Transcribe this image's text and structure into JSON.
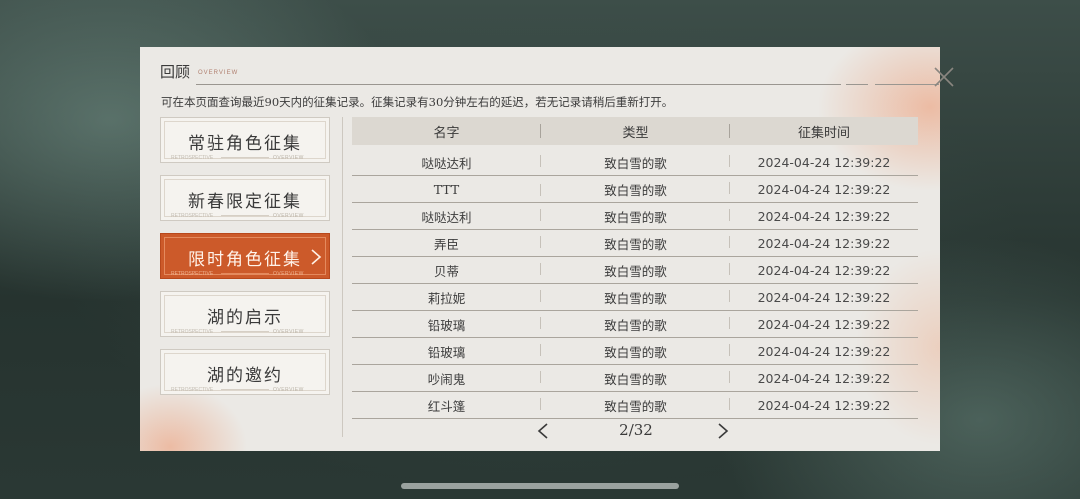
{
  "header": {
    "title": "回顾",
    "subtitle": "OVERVIEW",
    "notice": "可在本页面查询最近90天内的征集记录。征集记录有30分钟左右的延迟，若无记录请稍后重新打开。"
  },
  "tabs": [
    {
      "label": "常驻角色征集",
      "active": false,
      "deco": "OVERVIEW",
      "deco_left": "RETROSPECTIVE"
    },
    {
      "label": "新春限定征集",
      "active": false,
      "deco": "OVERVIEW",
      "deco_left": "RETROSPECTIVE"
    },
    {
      "label": "限时角色征集",
      "active": true,
      "deco": "OVERVIEW",
      "deco_left": "RETROSPECTIVE"
    },
    {
      "label": "湖的启示",
      "active": false,
      "deco": "OVERVIEW",
      "deco_left": "RETROSPECTIVE"
    },
    {
      "label": "湖的邀约",
      "active": false,
      "deco": "OVERVIEW",
      "deco_left": "RETROSPECTIVE"
    }
  ],
  "table": {
    "columns": [
      "名字",
      "类型",
      "征集时间"
    ],
    "rows": [
      [
        "哒哒达利",
        "致白雪的歌",
        "2024-04-24 12:39:22"
      ],
      [
        "TTT",
        "致白雪的歌",
        "2024-04-24 12:39:22"
      ],
      [
        "哒哒达利",
        "致白雪的歌",
        "2024-04-24 12:39:22"
      ],
      [
        "弄臣",
        "致白雪的歌",
        "2024-04-24 12:39:22"
      ],
      [
        "贝蒂",
        "致白雪的歌",
        "2024-04-24 12:39:22"
      ],
      [
        "莉拉妮",
        "致白雪的歌",
        "2024-04-24 12:39:22"
      ],
      [
        "铅玻璃",
        "致白雪的歌",
        "2024-04-24 12:39:22"
      ],
      [
        "铅玻璃",
        "致白雪的歌",
        "2024-04-24 12:39:22"
      ],
      [
        "吵闹鬼",
        "致白雪的歌",
        "2024-04-24 12:39:22"
      ],
      [
        "红斗篷",
        "致白雪的歌",
        "2024-04-24 12:39:22"
      ]
    ]
  },
  "pager": {
    "text": "2/32"
  },
  "icons": {
    "close": "close-icon",
    "prev": "chevron-left-icon",
    "next": "chevron-right-icon",
    "tab_arrow": "chevron-right-icon"
  },
  "colors": {
    "accent": "#cc5a2a",
    "panel": "#ebe9e5",
    "text": "#3a3a3a"
  }
}
